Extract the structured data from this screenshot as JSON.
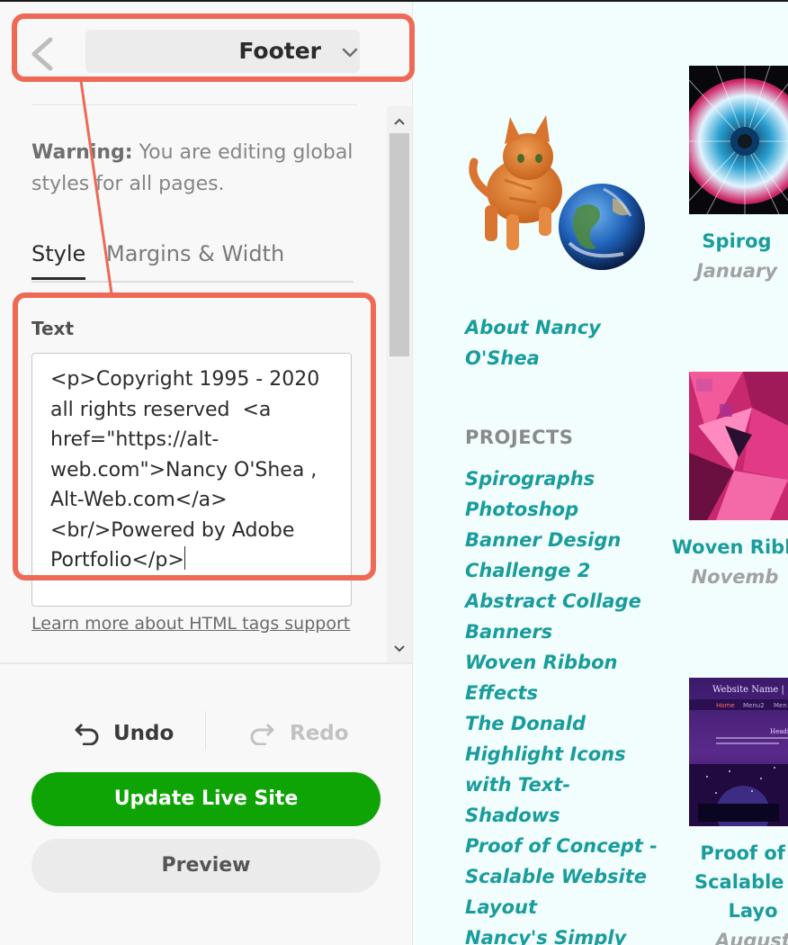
{
  "header": {
    "back_icon": "chevron-left-icon",
    "section_title": "Footer",
    "dropdown_icon": "chevron-down-icon"
  },
  "editor": {
    "warning_bold": "Warning:",
    "warning_text": " You are editing global styles for all pages.",
    "tabs": [
      {
        "label": "Style",
        "active": true
      },
      {
        "label": "Margins & Width",
        "active": false
      }
    ],
    "text_label": "Text",
    "text_value": "<p>Copyright 1995 - 2020 all rights reserved  <a href=\"https://alt-web.com\">Nancy O'Shea ,  Alt-Web.com</a><br/>Powered by Adobe Portfolio</p>",
    "learn_more": "Learn more about HTML tags support"
  },
  "actions": {
    "undo_label": "Undo",
    "redo_label": "Redo",
    "undo_icon": "undo-arrow-icon",
    "redo_icon": "redo-arrow-icon",
    "update_label": "Update Live Site",
    "preview_label": "Preview"
  },
  "colors": {
    "accent_green": "#0ea405",
    "highlight": "#ee6a56",
    "site_link": "#1a9c9c",
    "site_bg": "#f2fefe"
  },
  "site": {
    "about_label": "About Nancy O'Shea",
    "projects_heading": "PROJECTS",
    "projects": [
      "Spirographs",
      "Photoshop",
      "Banner Design",
      "Challenge 2",
      "Abstract Collage",
      "Banners",
      "Woven Ribbon",
      "Effects",
      "The Donald",
      "Highlight Icons",
      "with Text-",
      "Shadows",
      "Proof of Concept -",
      "Scalable Website",
      "Layout",
      "Nancy's Simply"
    ],
    "cards": [
      {
        "title": "Spirog",
        "date": "January"
      },
      {
        "title": "Woven Ribb",
        "date": "Novemb"
      },
      {
        "title": "Proof of C",
        "title2": "Scalable W",
        "title3": "Layo",
        "date": "August"
      }
    ],
    "thumb3_text": {
      "site_name": "Website Name |",
      "nav1": "Home",
      "nav2": "Menu2",
      "nav3": "Men",
      "heading": "Headi"
    }
  }
}
